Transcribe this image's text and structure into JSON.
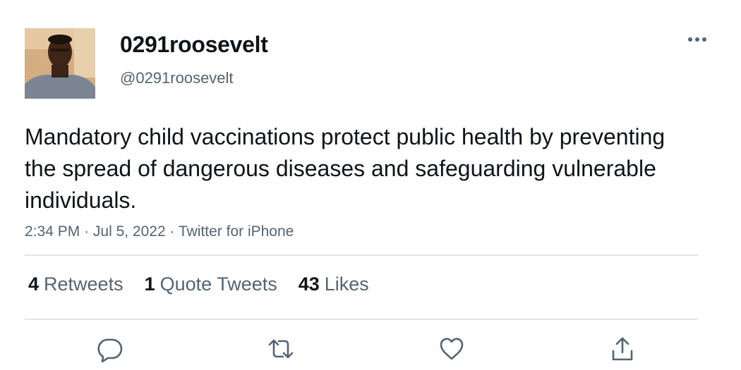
{
  "author": {
    "display_name": "0291roosevelt",
    "handle": "@0291roosevelt",
    "avatar_icon": "user-avatar-photo"
  },
  "tweet": {
    "text": "Mandatory child vaccinations protect public health by preventing the spread of dangerous diseases and safeguarding vulnerable individuals.",
    "time": "2:34 PM",
    "separator": "·",
    "date": "Jul 5, 2022",
    "source": "Twitter for iPhone"
  },
  "stats": {
    "retweets_count": "4",
    "retweets_label": "Retweets",
    "quotes_count": "1",
    "quotes_label": "Quote Tweets",
    "likes_count": "43",
    "likes_label": "Likes"
  },
  "actions": {
    "reply_icon": "reply-bubble-icon",
    "retweet_icon": "retweet-arrows-icon",
    "like_icon": "heart-icon",
    "share_icon": "share-upload-icon",
    "more_icon": "more-dots-icon"
  },
  "colors": {
    "text_primary": "#0f1419",
    "text_secondary": "#536471",
    "divider": "#e1e5e8"
  }
}
